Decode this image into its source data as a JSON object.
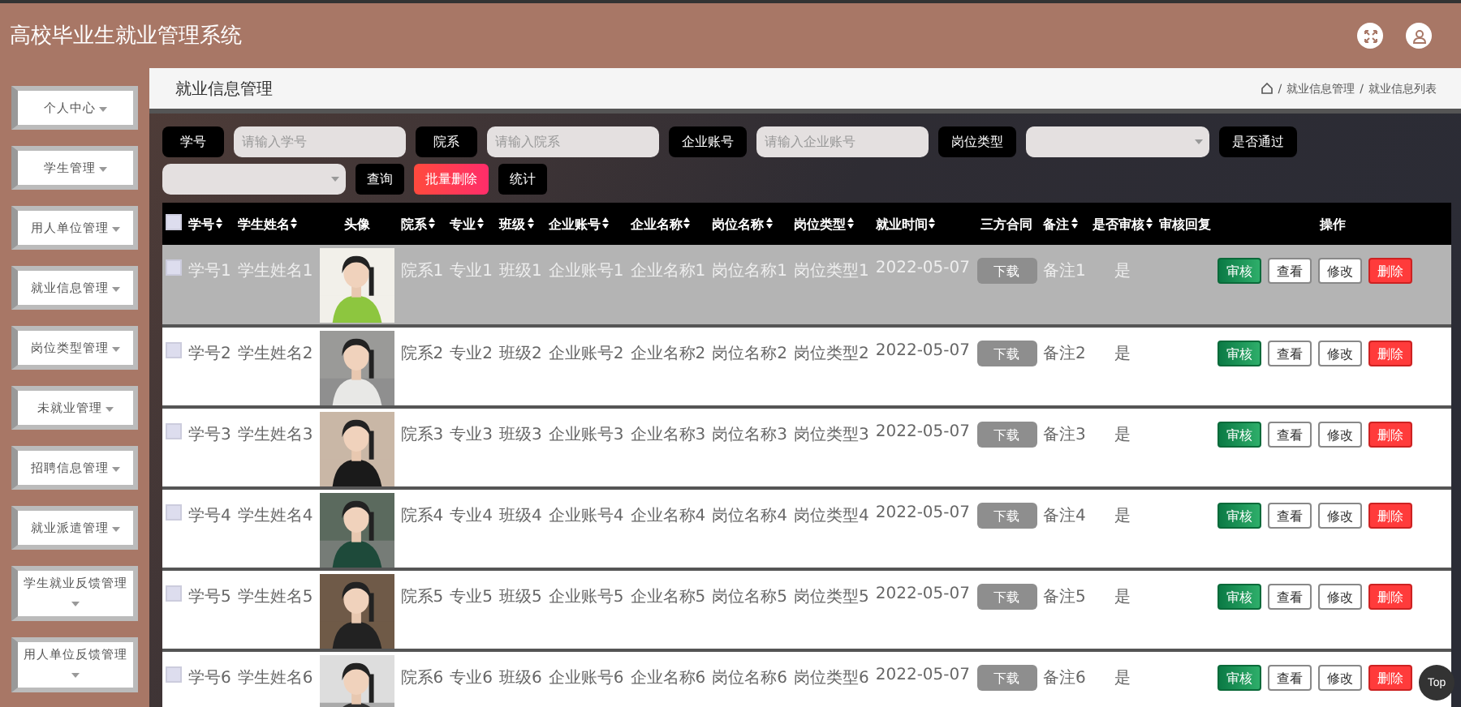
{
  "header": {
    "title": "高校毕业生就业管理系统"
  },
  "sidebar": {
    "items": [
      {
        "label": "个人中心"
      },
      {
        "label": "学生管理"
      },
      {
        "label": "用人单位管理"
      },
      {
        "label": "就业信息管理"
      },
      {
        "label": "岗位类型管理"
      },
      {
        "label": "未就业管理"
      },
      {
        "label": "招聘信息管理"
      },
      {
        "label": "就业派遣管理"
      },
      {
        "label": "学生就业反馈管理"
      },
      {
        "label": "用人单位反馈管理"
      }
    ]
  },
  "page": {
    "title": "就业信息管理",
    "breadcrumb": [
      "/",
      "就业信息管理",
      "/",
      "就业信息列表"
    ]
  },
  "filters": [
    {
      "kind": "input",
      "label": "学号",
      "placeholder": "请输入学号"
    },
    {
      "kind": "input",
      "label": "院系",
      "placeholder": "请输入院系"
    },
    {
      "kind": "input",
      "label": "企业账号",
      "placeholder": "请输入企业账号"
    },
    {
      "kind": "select",
      "label": "岗位类型"
    },
    {
      "kind": "select",
      "label": "是否通过"
    }
  ],
  "actions": [
    {
      "label": "查询",
      "kind": "dark"
    },
    {
      "label": "批量删除",
      "kind": "danger"
    },
    {
      "label": "统计",
      "kind": "dark"
    }
  ],
  "table": {
    "select_all_checked": false,
    "columns": [
      {
        "label": "学号",
        "sortable": true
      },
      {
        "label": "学生姓名",
        "sortable": true
      },
      {
        "label": "头像",
        "sortable": false
      },
      {
        "label": "院系",
        "sortable": true
      },
      {
        "label": "专业",
        "sortable": true
      },
      {
        "label": "班级",
        "sortable": true
      },
      {
        "label": "企业账号",
        "sortable": true
      },
      {
        "label": "企业名称",
        "sortable": true
      },
      {
        "label": "岗位名称",
        "sortable": true
      },
      {
        "label": "岗位类型",
        "sortable": true
      },
      {
        "label": "就业时间",
        "sortable": true
      },
      {
        "label": "三方合同",
        "sortable": false
      },
      {
        "label": "备注",
        "sortable": true
      },
      {
        "label": "是否审核",
        "sortable": true
      },
      {
        "label": "审核回复",
        "sortable": false
      },
      {
        "label": "操作",
        "sortable": false
      }
    ],
    "rows": [
      {
        "highlighted": true,
        "checked": false,
        "cells": [
          "学号1",
          "学生姓名1",
          "",
          "院系1",
          "专业1",
          "班级1",
          "企业账号1",
          "企业名称1",
          "岗位名称1",
          "岗位类型1",
          "2022-05-07",
          "下载",
          "备注1",
          "是",
          ""
        ],
        "buttons": [
          {
            "label": "审核",
            "kind": "success"
          },
          {
            "label": "查看",
            "kind": "outline"
          },
          {
            "label": "修改",
            "kind": "outline"
          },
          {
            "label": "删除",
            "kind": "danger"
          }
        ]
      },
      {
        "highlighted": false,
        "checked": false,
        "cells": [
          "学号2",
          "学生姓名2",
          "",
          "院系2",
          "专业2",
          "班级2",
          "企业账号2",
          "企业名称2",
          "岗位名称2",
          "岗位类型2",
          "2022-05-07",
          "下载",
          "备注2",
          "是",
          ""
        ],
        "buttons": [
          {
            "label": "审核",
            "kind": "success"
          },
          {
            "label": "查看",
            "kind": "outline"
          },
          {
            "label": "修改",
            "kind": "outline"
          },
          {
            "label": "删除",
            "kind": "danger"
          }
        ]
      },
      {
        "highlighted": false,
        "checked": false,
        "cells": [
          "学号3",
          "学生姓名3",
          "",
          "院系3",
          "专业3",
          "班级3",
          "企业账号3",
          "企业名称3",
          "岗位名称3",
          "岗位类型3",
          "2022-05-07",
          "下载",
          "备注3",
          "是",
          ""
        ],
        "buttons": [
          {
            "label": "审核",
            "kind": "success"
          },
          {
            "label": "查看",
            "kind": "outline"
          },
          {
            "label": "修改",
            "kind": "outline"
          },
          {
            "label": "删除",
            "kind": "danger"
          }
        ]
      },
      {
        "highlighted": false,
        "checked": false,
        "cells": [
          "学号4",
          "学生姓名4",
          "",
          "院系4",
          "专业4",
          "班级4",
          "企业账号4",
          "企业名称4",
          "岗位名称4",
          "岗位类型4",
          "2022-05-07",
          "下载",
          "备注4",
          "是",
          ""
        ],
        "buttons": [
          {
            "label": "审核",
            "kind": "success"
          },
          {
            "label": "查看",
            "kind": "outline"
          },
          {
            "label": "修改",
            "kind": "outline"
          },
          {
            "label": "删除",
            "kind": "danger"
          }
        ]
      },
      {
        "highlighted": false,
        "checked": false,
        "cells": [
          "学号5",
          "学生姓名5",
          "",
          "院系5",
          "专业5",
          "班级5",
          "企业账号5",
          "企业名称5",
          "岗位名称5",
          "岗位类型5",
          "2022-05-07",
          "下载",
          "备注5",
          "是",
          ""
        ],
        "buttons": [
          {
            "label": "审核",
            "kind": "success"
          },
          {
            "label": "查看",
            "kind": "outline"
          },
          {
            "label": "修改",
            "kind": "outline"
          },
          {
            "label": "删除",
            "kind": "danger"
          }
        ]
      },
      {
        "highlighted": false,
        "checked": false,
        "cells": [
          "学号6",
          "学生姓名6",
          "",
          "院系6",
          "专业6",
          "班级6",
          "企业账号6",
          "企业名称6",
          "岗位名称6",
          "岗位类型6",
          "2022-05-07",
          "下载",
          "备注6",
          "是",
          ""
        ],
        "buttons": [
          {
            "label": "审核",
            "kind": "success"
          },
          {
            "label": "查看",
            "kind": "outline"
          },
          {
            "label": "修改",
            "kind": "outline"
          },
          {
            "label": "删除",
            "kind": "danger"
          }
        ]
      }
    ]
  },
  "top_button": "Top"
}
